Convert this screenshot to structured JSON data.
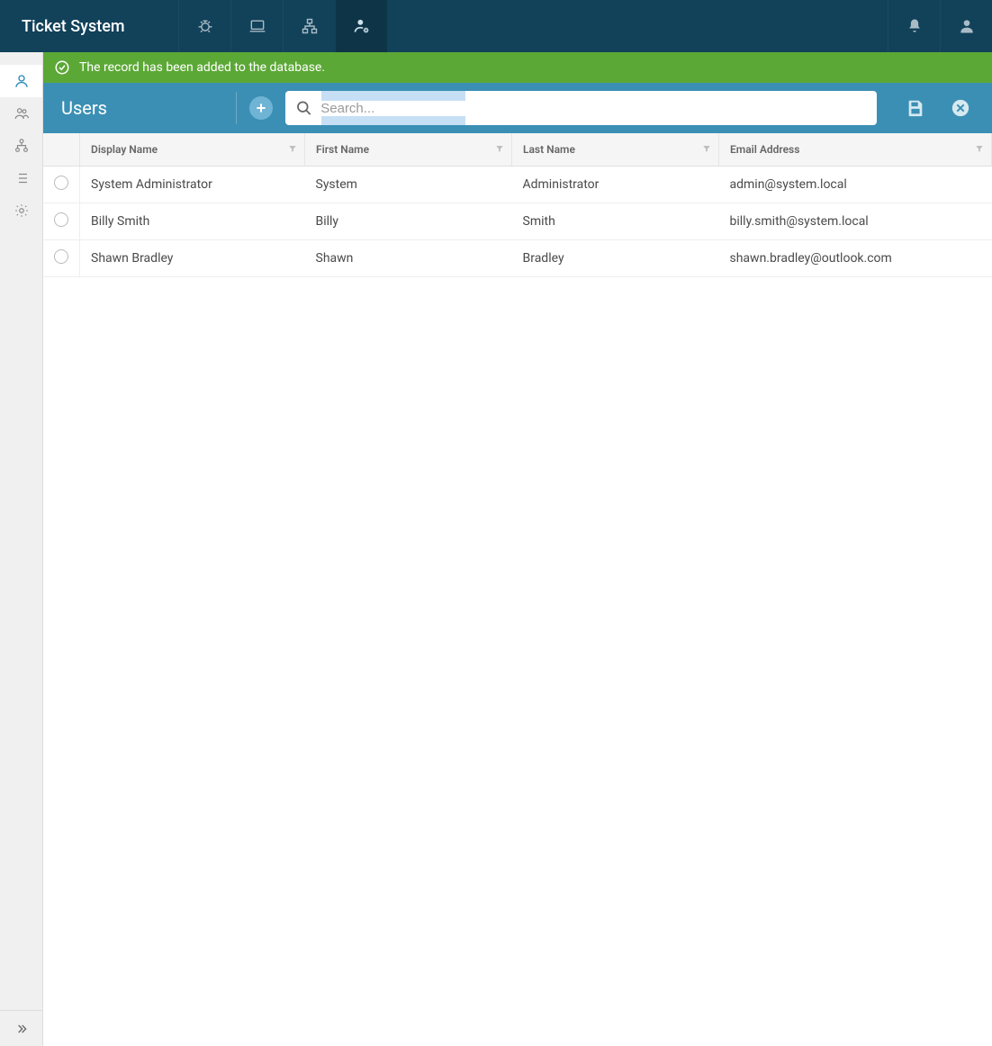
{
  "brand": "Ticket System",
  "topnav": [
    {
      "name": "bug-icon"
    },
    {
      "name": "laptop-icon"
    },
    {
      "name": "network-icon"
    },
    {
      "name": "user-settings-icon",
      "active": true
    }
  ],
  "topright": [
    {
      "name": "bell-icon"
    },
    {
      "name": "profile-icon"
    }
  ],
  "sidebar": [
    {
      "name": "user-icon",
      "active": true
    },
    {
      "name": "users-group-icon"
    },
    {
      "name": "org-tree-icon"
    },
    {
      "name": "list-icon"
    },
    {
      "name": "gear-icon"
    }
  ],
  "banner": {
    "message": "The record has been added to the database."
  },
  "pageheader": {
    "title": "Users",
    "search_placeholder": "Search..."
  },
  "table": {
    "columns": [
      "Display Name",
      "First Name",
      "Last Name",
      "Email Address"
    ],
    "rows": [
      {
        "display": "System Administrator",
        "first": "System",
        "last": "Administrator",
        "email": "admin@system.local"
      },
      {
        "display": "Billy Smith",
        "first": "Billy",
        "last": "Smith",
        "email": "billy.smith@system.local"
      },
      {
        "display": "Shawn Bradley",
        "first": "Shawn",
        "last": "Bradley",
        "email": "shawn.bradley@outlook.com"
      }
    ]
  }
}
